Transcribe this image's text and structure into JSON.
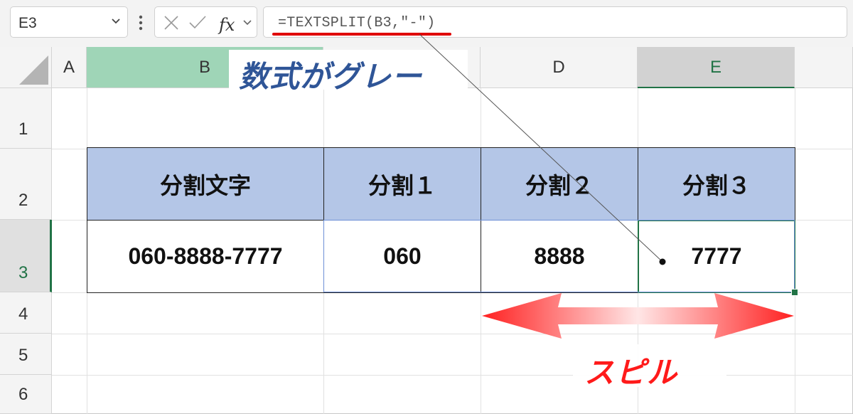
{
  "formula_bar": {
    "name_box": "E3",
    "formula": "=TEXTSPLIT(B3,\"-\")",
    "fx_label": "fx"
  },
  "columns": [
    "A",
    "B",
    "D",
    "E"
  ],
  "rows": [
    "1",
    "2",
    "3",
    "4",
    "5",
    "6"
  ],
  "table": {
    "headers": [
      "分割文字",
      "分割１",
      "分割２",
      "分割３"
    ],
    "values": [
      "060-8888-7777",
      "060",
      "8888",
      "7777"
    ]
  },
  "annotations": {
    "gray_formula": "数式がグレー",
    "spill": "スピル"
  },
  "colors": {
    "header_fill": "#b4c6e7",
    "selected_col_b": "#9fd5b7",
    "active_border": "#217346",
    "annotation_blue": "#2f5597",
    "annotation_red": "#ff1a1a"
  }
}
